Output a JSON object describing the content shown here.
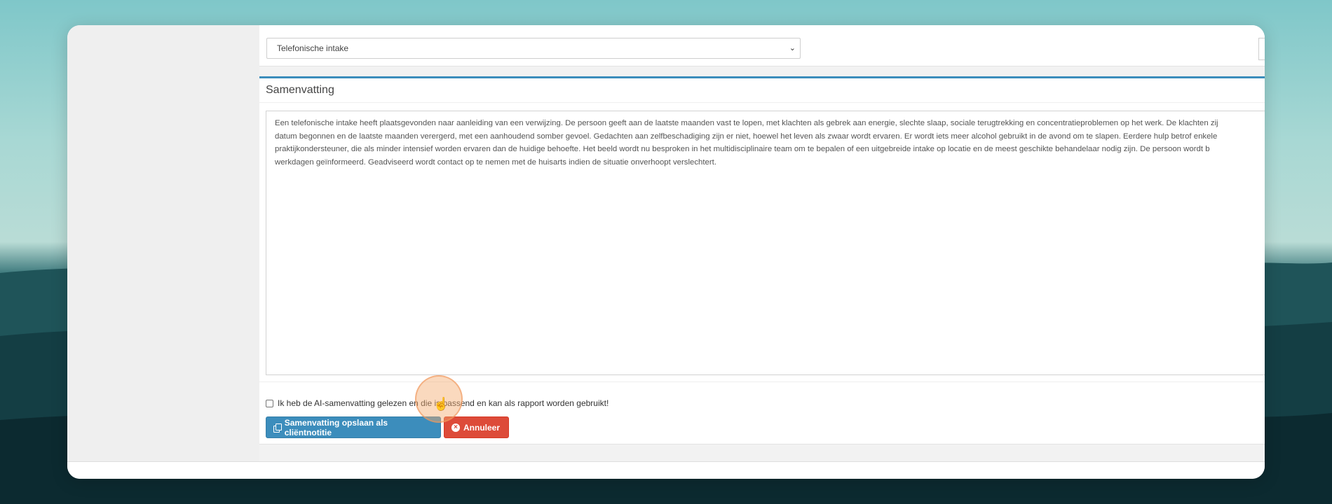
{
  "appointment_select": {
    "selected": "Telefonische intake"
  },
  "summary_panel": {
    "title": "Samenvatting",
    "text_lines": [
      "Een telefonische intake heeft plaatsgevonden naar aanleiding van een verwijzing. De persoon geeft aan de laatste maanden vast te lopen, met klachten als gebrek aan energie, slechte slaap, sociale terugtrekking en concentratieproblemen op het werk. De klachten zij",
      "datum begonnen en de laatste maanden verergerd, met een aanhoudend somber gevoel. Gedachten aan zelfbeschadiging zijn er niet, hoewel het leven als zwaar wordt ervaren. Er wordt iets meer alcohol gebruikt in de avond om te slapen. Eerdere hulp betrof enkele",
      "praktijkondersteuner, die als minder intensief worden ervaren dan de huidige behoefte. Het beeld wordt nu besproken in het multidisciplinaire team om te bepalen of een uitgebreide intake op locatie en de meest geschikte behandelaar nodig zijn. De persoon wordt b",
      "werkdagen geïnformeerd. Geadviseerd wordt contact op te nemen met de huisarts indien de situatie onverhoopt verslechtert."
    ]
  },
  "confirm": {
    "label": "Ik heb de AI-samenvatting gelezen en die is passend en kan als rapport worden gebruikt!",
    "checked": false
  },
  "actions": {
    "save_label": "Samenvatting opslaan als cliëntnotitie",
    "cancel_label": "Annuleer"
  },
  "icons": {
    "save": "copy-icon",
    "cancel": "times-circle-icon",
    "select": "chevron-down-icon",
    "cursor": "hand-pointer-icon"
  },
  "colors": {
    "primary": "#3c8dbc",
    "danger": "#dd4b39",
    "cursor_highlight": "#f5aa6e"
  }
}
